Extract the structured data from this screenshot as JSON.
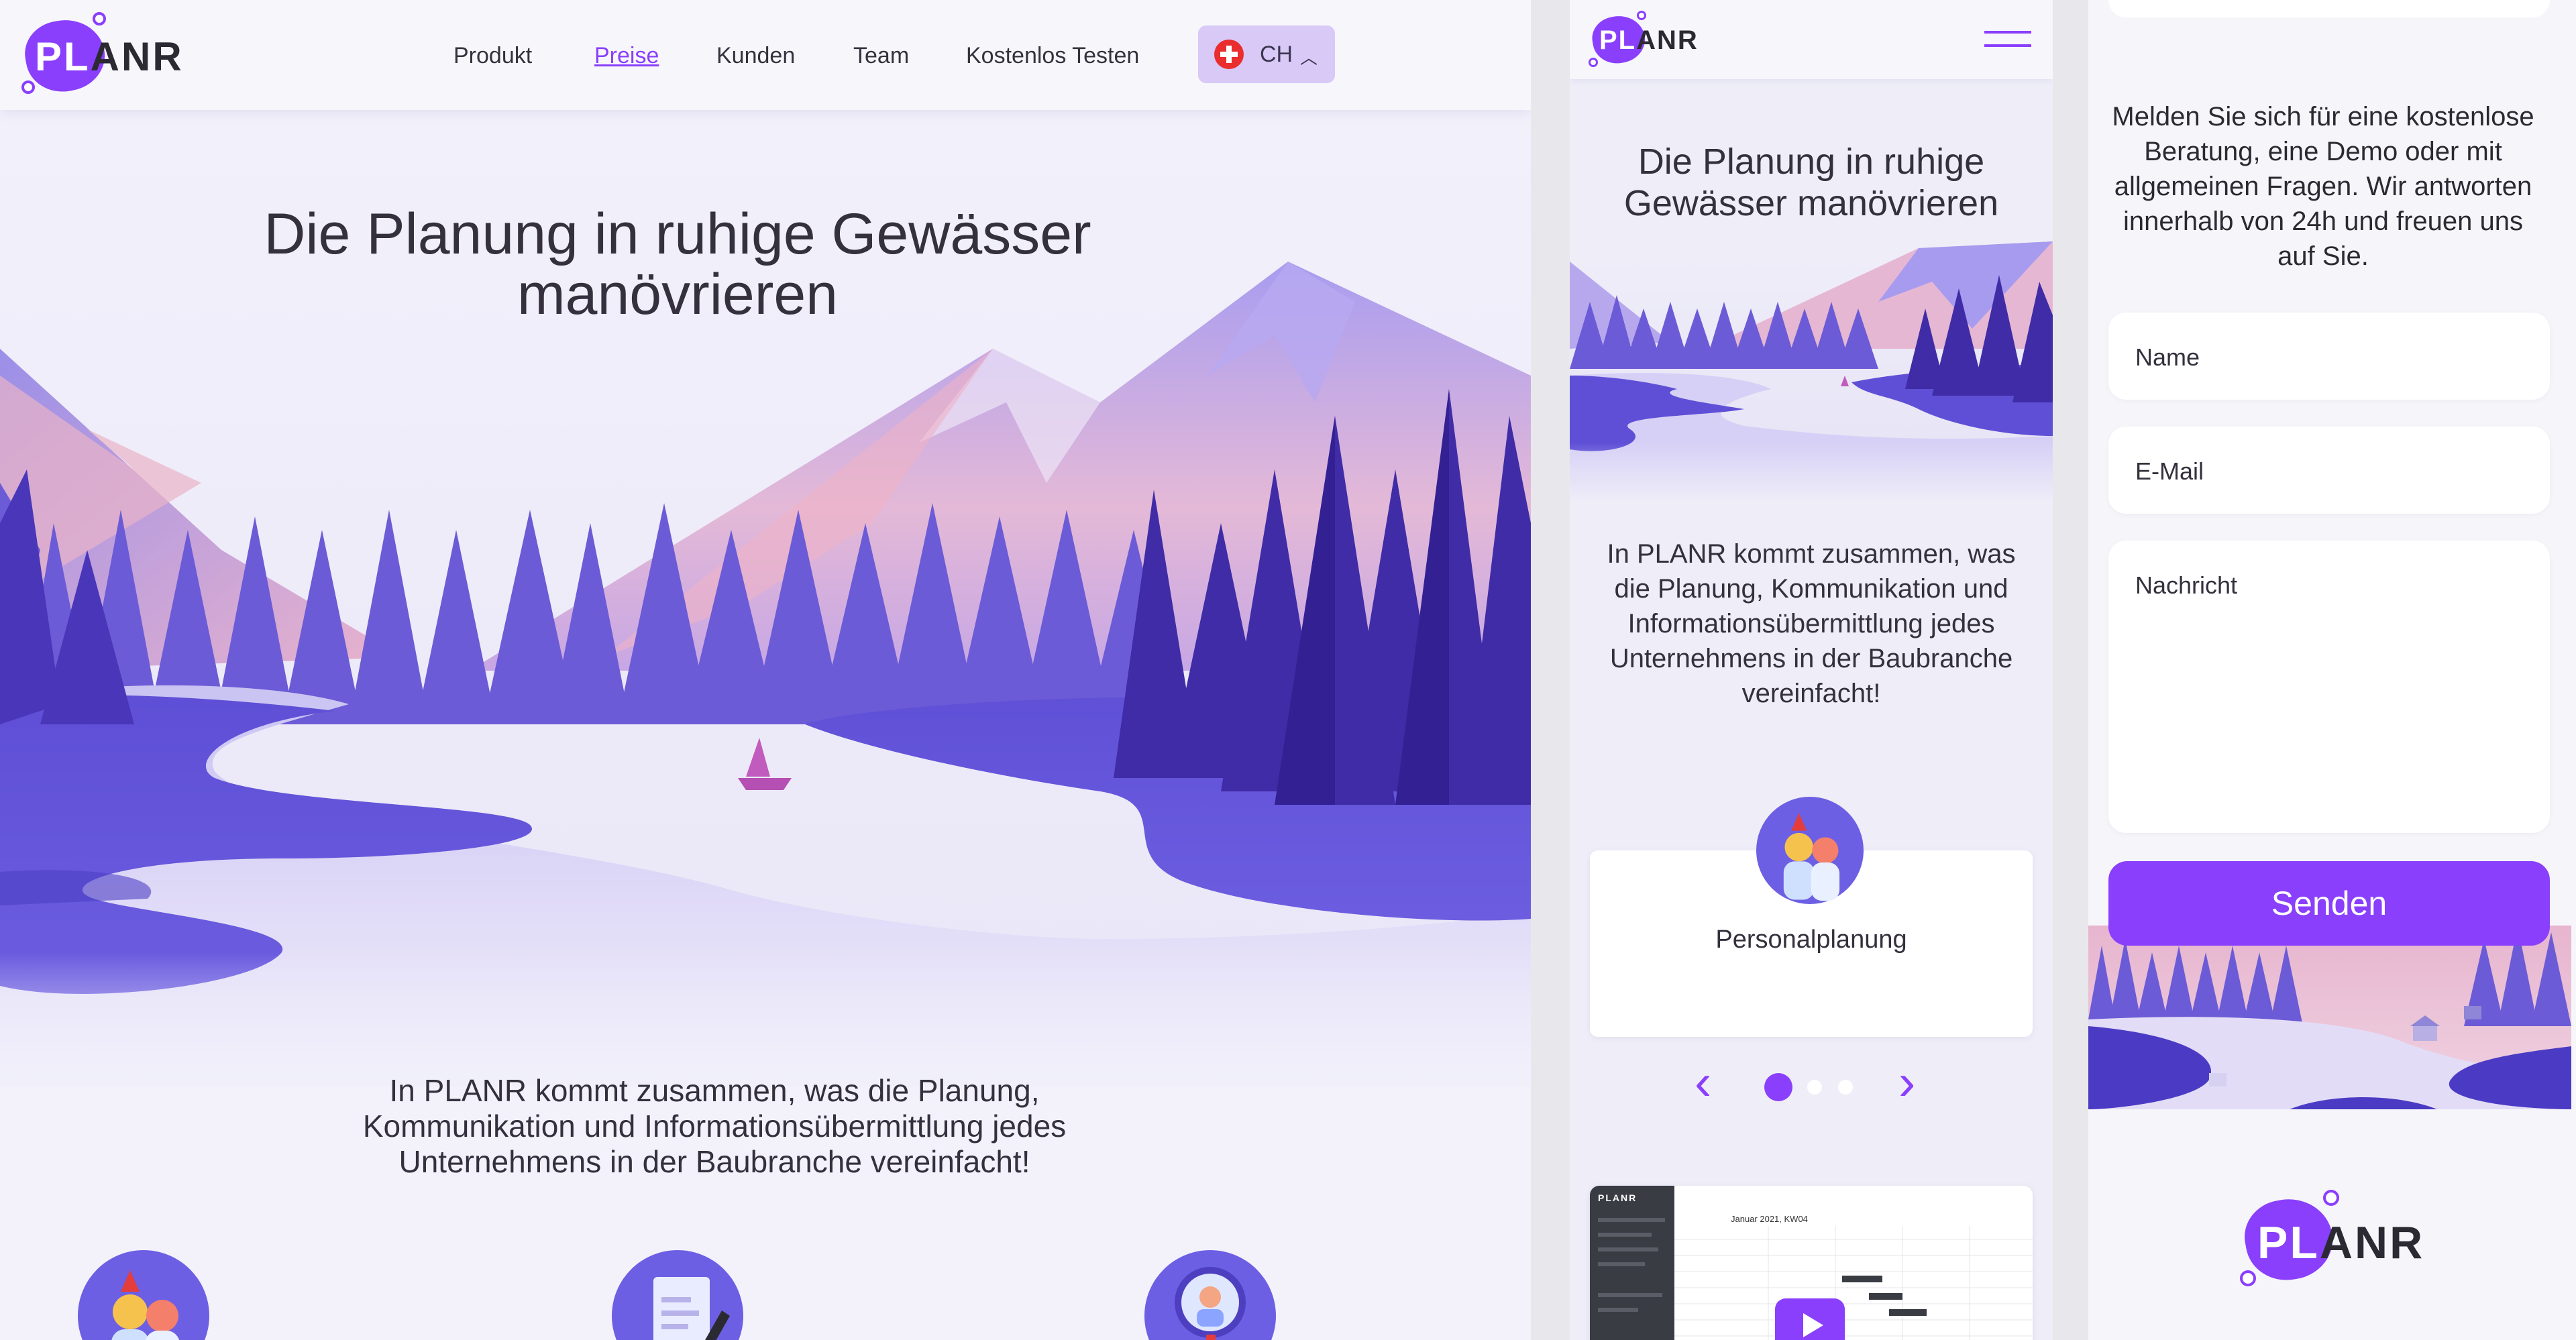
{
  "brand": {
    "logo": "PLANR",
    "colors": {
      "accent": "#8a3ffc",
      "text": "#2b2a33",
      "bg": "#f3f2fb"
    }
  },
  "desktop": {
    "nav": {
      "items": [
        {
          "label": "Produkt"
        },
        {
          "label": "Preise",
          "active": true
        },
        {
          "label": "Kunden"
        },
        {
          "label": "Team"
        },
        {
          "label": "Kostenlos Testen"
        }
      ],
      "lang": {
        "code": "CH",
        "flag_icon": "swiss-flag-icon",
        "chevron_icon": "chevron-up-icon"
      }
    },
    "hero": {
      "title_line1": "Die Planung in ruhige Gewässer",
      "title_line2": "manövrieren",
      "illustration": "mountain-lake-landscape"
    },
    "intro": {
      "line1": "In PLANR kommt zusammen, was die Planung,",
      "line2": "Kommunikation und Informationsübermittlung jedes",
      "line3": "Unternehmens in der Baubranche vereinfacht!"
    },
    "feature_icons": [
      "people-icon",
      "document-pen-icon",
      "magnifier-person-icon"
    ]
  },
  "mobile": {
    "hero": {
      "title_line1": "Die Planung in ruhige",
      "title_line2": "Gewässer manövrieren"
    },
    "intro": {
      "line1": "In PLANR kommt zusammen, was",
      "line2": "die Planung, Kommunikation und",
      "line3": "Informationsübermittlung jedes",
      "line4": "Unternehmens in der Baubranche",
      "line5": "vereinfacht!"
    },
    "carousel": {
      "card_label": "Personalplanung",
      "card_icon": "people-icon",
      "active_index": 0,
      "count": 3,
      "prev_icon": "chevron-left-icon",
      "next_icon": "chevron-right-icon"
    },
    "video": {
      "brand": "PLANR",
      "title": "Januar 2021, KW04",
      "play_icon": "play-icon"
    }
  },
  "contact": {
    "intro_line1": "Melden Sie sich für eine kostenlose",
    "intro_line2": "Beratung, eine Demo oder mit",
    "intro_line3": "allgemeinen Fragen. Wir antworten",
    "intro_line4": "innerhalb von 24h und freuen uns",
    "intro_line5": "auf Sie.",
    "fields": {
      "name": "Name",
      "email": "E-Mail",
      "message": "Nachricht"
    },
    "submit_label": "Senden"
  }
}
